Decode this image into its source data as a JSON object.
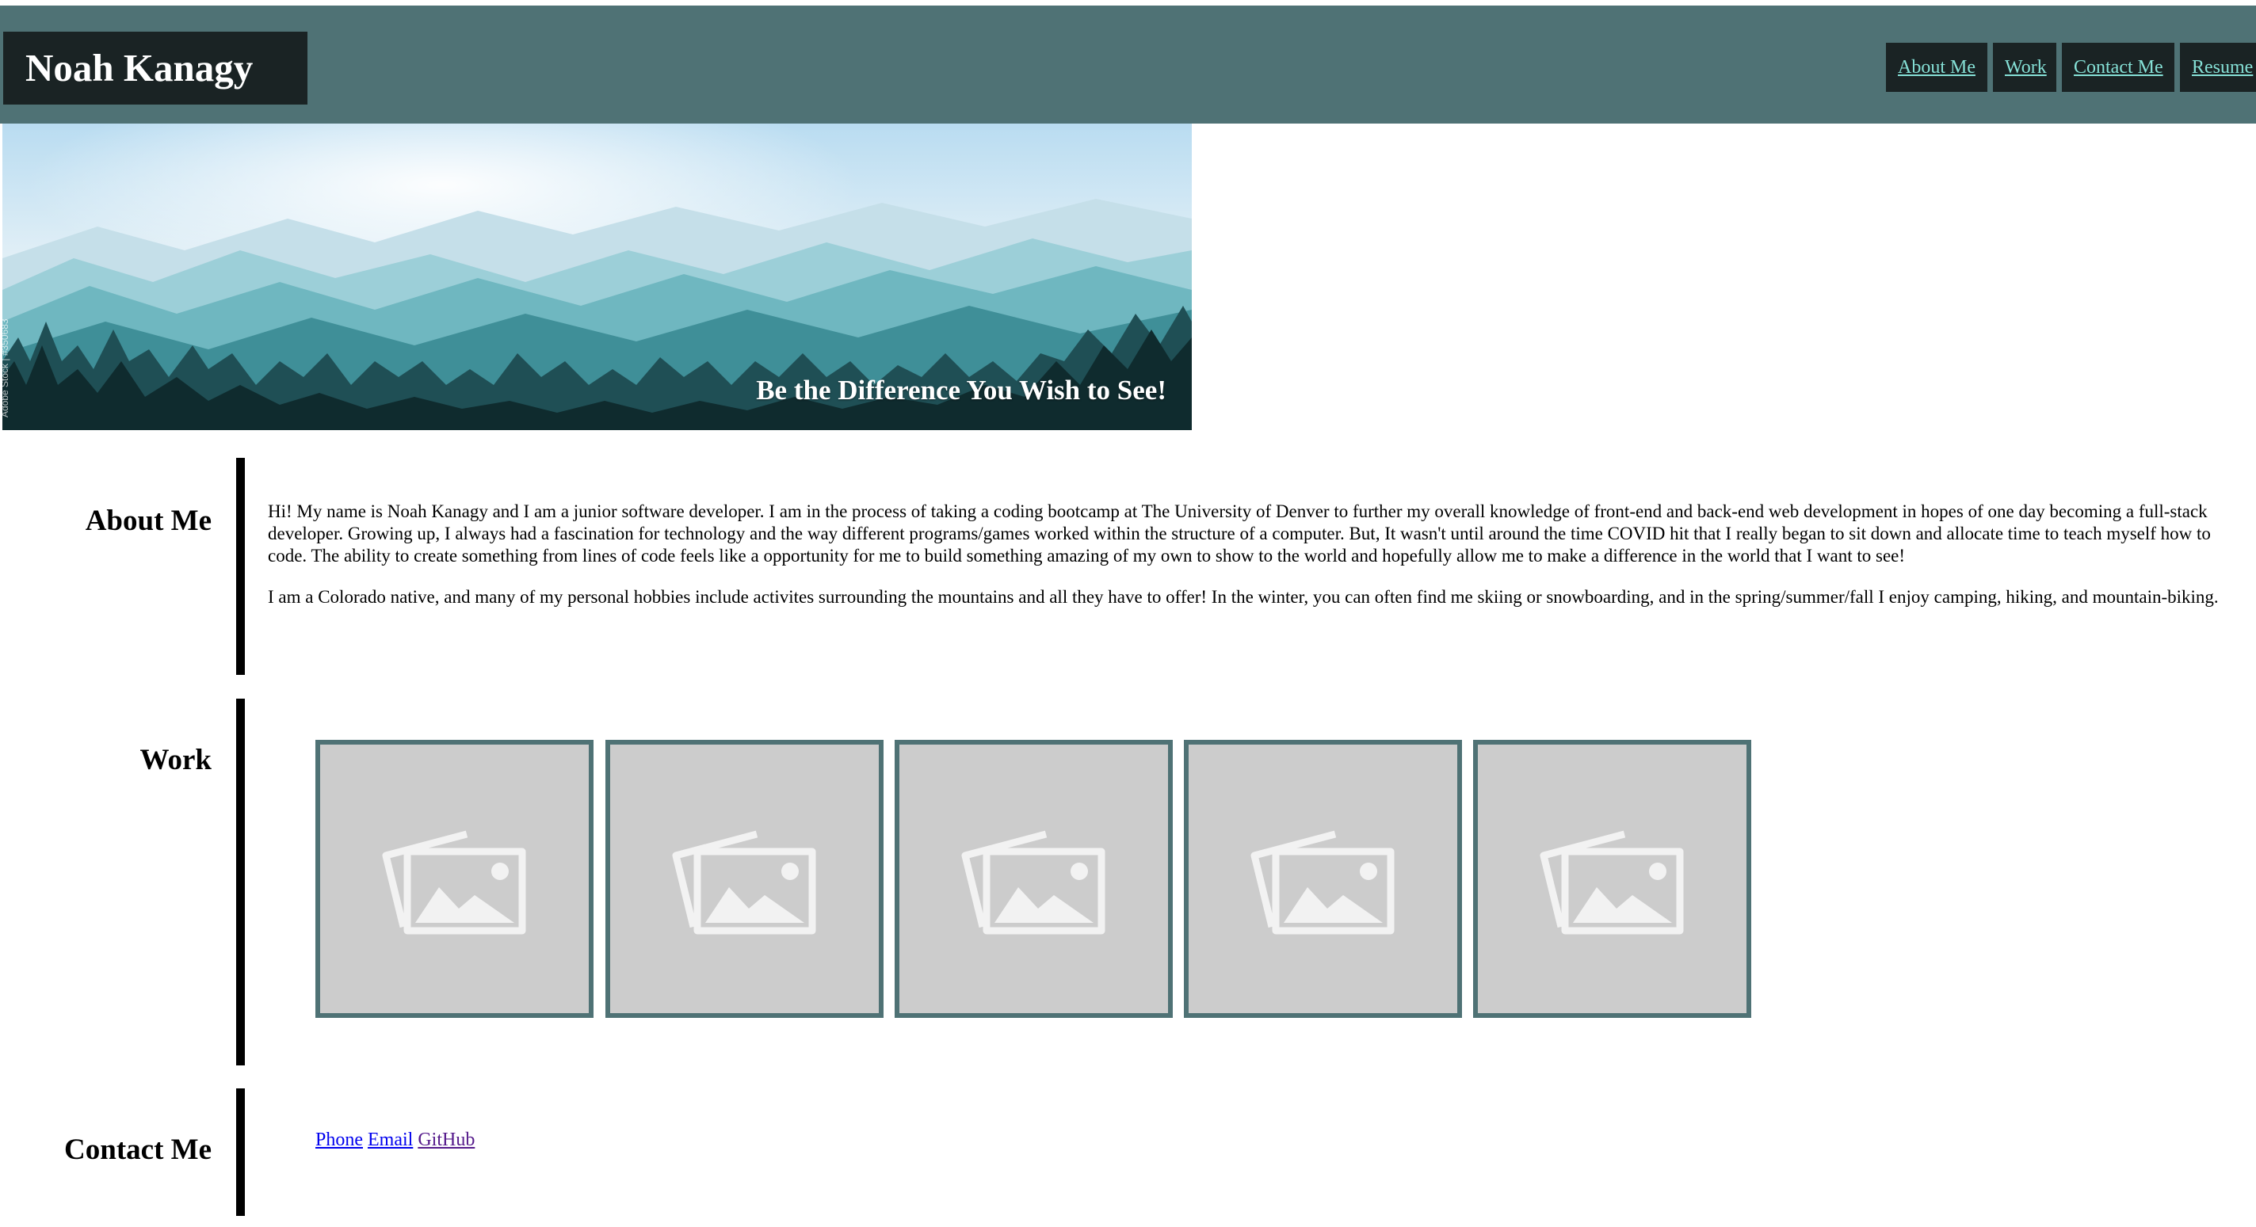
{
  "header": {
    "title": "Noah Kanagy",
    "nav": [
      "About Me",
      "Work",
      "Contact Me",
      "Resume"
    ]
  },
  "hero": {
    "caption": "Be the Difference You Wish to See!",
    "stock_mark": "Adobe Stock | #350683"
  },
  "about": {
    "title": "About Me",
    "paragraphs": [
      "Hi! My name is Noah Kanagy and I am a junior software developer. I am in the process of taking a coding bootcamp at The University of Denver to further my overall knowledge of front-end and back-end web development in hopes of one day becoming a full-stack developer. Growing up, I always had a fascination for technology and the way different programs/games worked within the structure of a computer. But, It wasn't until around the time COVID hit that I really began to sit down and allocate time to teach myself how to code. The ability to create something from lines of code feels like a opportunity for me to build something amazing of my own to show to the world and hopefully allow me to make a difference in the world that I want to see!",
      "I am a Colorado native, and many of my personal hobbies include activites surrounding the mountains and all they have to offer! In the winter, you can often find me skiing or snowboarding, and in the spring/summer/fall I enjoy camping, hiking, and mountain-biking."
    ]
  },
  "work": {
    "title": "Work",
    "card_icon": "image-placeholder-icon",
    "card_count": 5
  },
  "contact": {
    "title": "Contact Me",
    "links": [
      "Phone",
      "Email",
      "GitHub"
    ]
  },
  "colors": {
    "header_bg": "#4f7275",
    "logo_bg": "#1a2324",
    "nav_link": "#85e0d6",
    "card_border": "#4f7275",
    "card_bg": "#cccccc"
  }
}
